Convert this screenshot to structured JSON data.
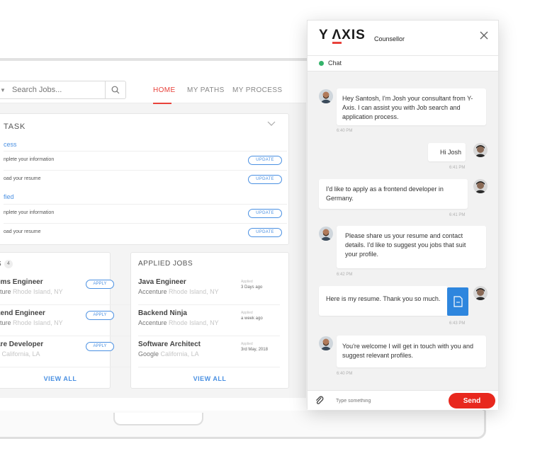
{
  "app": {
    "search": {
      "placeholder": "Search Jobs..."
    },
    "nav": {
      "home": "HOME",
      "my_paths": "MY PATHS",
      "my_process": "MY PROCESS"
    },
    "task": {
      "title": "TASK",
      "section1": "cess",
      "section2": "fied",
      "rows": [
        {
          "label": "nplete your information",
          "button": "UPDATE"
        },
        {
          "label": "oad your resume",
          "button": "UPDATE"
        },
        {
          "label": "nplete your information",
          "button": "UPDATE"
        },
        {
          "label": "oad your resume",
          "button": "UPDATE"
        }
      ]
    },
    "saved_jobs": {
      "title": "S",
      "count": "4",
      "items": [
        {
          "title": "ems Engineer",
          "company": "nture",
          "location": "Rhode Island, NY",
          "button": "APPLY"
        },
        {
          "title": "kend Engineer",
          "company": "nture",
          "location": "Rhode Island, NY",
          "button": "APPLY"
        },
        {
          "title": "are Developer",
          "company": "e",
          "location": "California, LA",
          "button": "APPLY"
        }
      ],
      "view_all": "VIEW ALL"
    },
    "applied_jobs": {
      "title": "APPLIED JOBS",
      "items": [
        {
          "title": "Java Engineer",
          "company": "Accenture",
          "location": "Rhode Island, NY",
          "applied_label": "Applied",
          "applied_date": "3 Days ago"
        },
        {
          "title": "Backend Ninja",
          "company": "Accenture",
          "location": "Rhode Island, NY",
          "applied_label": "Applied",
          "applied_date": "a week ago"
        },
        {
          "title": "Software Architect",
          "company": "Google",
          "location": "California, LA",
          "applied_label": "Applied",
          "applied_date": "3rd May, 2018"
        }
      ],
      "view_all": "VIEW ALL"
    }
  },
  "chat": {
    "brand": "Y ΛXIS",
    "brand_subtitle": "Counsellor",
    "status": "Chat",
    "status_color": "#35b36b",
    "accent_color": "#e8281e",
    "messages": [
      {
        "from": "consultant",
        "text": "Hey Santosh, I'm Josh your consultant from Y-Axis. I can assist you with Job search and application process.",
        "time": "6:40 PM"
      },
      {
        "from": "user",
        "text": "Hi Josh",
        "time": "6:41 PM"
      },
      {
        "from": "user",
        "text": "I'd like to apply as a frontend developer in Germany.",
        "time": "6:41 PM"
      },
      {
        "from": "consultant",
        "text": "Please share us your resume and contact details. I'd like to suggest you jobs that suit your profile.",
        "time": "6:42 PM"
      },
      {
        "from": "user",
        "text": "Here is my resume. Thank you so much.",
        "time": "6:43 PM",
        "attachment_icon": "document-icon"
      },
      {
        "from": "consultant",
        "text": "You're welcome I will get in touch with you and suggest relevant profiles.",
        "time": "6:40 PM"
      }
    ],
    "composer": {
      "placeholder": "Type something",
      "send_label": "Send"
    }
  }
}
